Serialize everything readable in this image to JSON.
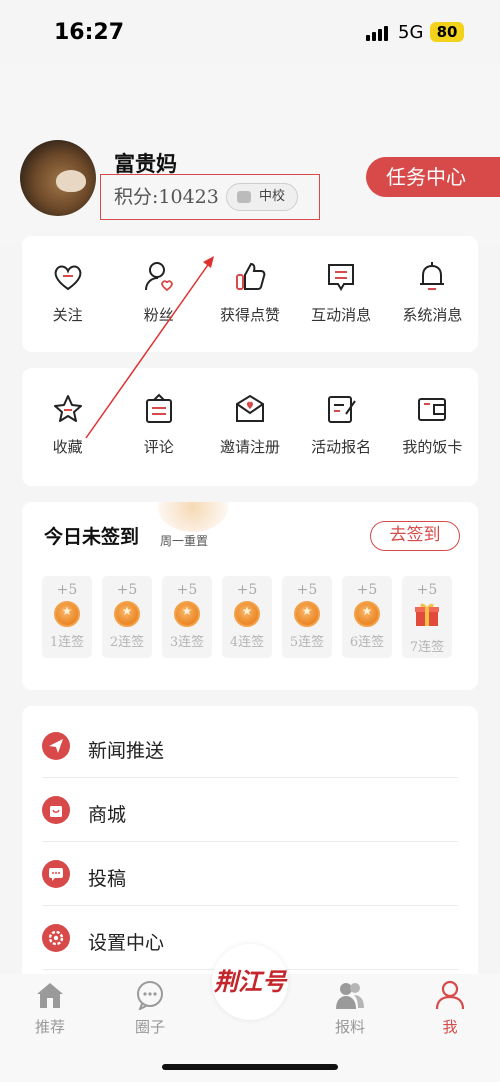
{
  "status_bar": {
    "time": "16:27",
    "network": "5G",
    "battery": "80"
  },
  "profile": {
    "username": "富贵妈",
    "points": "积分:10423",
    "level": "中校",
    "task_center": "任务中心"
  },
  "activity_row": [
    {
      "label": "关注",
      "icon": "heart-icon"
    },
    {
      "label": "粉丝",
      "icon": "fans-icon"
    },
    {
      "label": "获得点赞",
      "icon": "thumbs-up-icon"
    },
    {
      "label": "互动消息",
      "icon": "message-icon"
    },
    {
      "label": "系统消息",
      "icon": "bell-icon"
    }
  ],
  "service_row": [
    {
      "label": "收藏",
      "icon": "star-icon"
    },
    {
      "label": "评论",
      "icon": "comment-icon"
    },
    {
      "label": "邀请注册",
      "icon": "invite-icon"
    },
    {
      "label": "活动报名",
      "icon": "signup-icon"
    },
    {
      "label": "我的饭卡",
      "icon": "wallet-icon"
    }
  ],
  "signin": {
    "title": "今日未签到",
    "subtitle": "周一重置",
    "button": "去签到",
    "days": [
      {
        "plus": "+5",
        "label": "1连签"
      },
      {
        "plus": "+5",
        "label": "2连签"
      },
      {
        "plus": "+5",
        "label": "3连签"
      },
      {
        "plus": "+5",
        "label": "4连签"
      },
      {
        "plus": "+5",
        "label": "5连签"
      },
      {
        "plus": "+5",
        "label": "6连签"
      },
      {
        "plus": "+5",
        "label": "7连签"
      }
    ]
  },
  "menu": [
    {
      "label": "新闻推送",
      "icon": "paper-plane-icon"
    },
    {
      "label": "商城",
      "icon": "shop-bag-icon"
    },
    {
      "label": "投稿",
      "icon": "chat-dots-icon"
    },
    {
      "label": "设置中心",
      "icon": "gear-icon"
    }
  ],
  "tabbar": {
    "tabs": [
      {
        "label": "推荐",
        "icon": "home-icon"
      },
      {
        "label": "圈子",
        "icon": "circle-chat-icon"
      },
      {
        "label": "报料",
        "icon": "people-icon"
      },
      {
        "label": "我",
        "icon": "user-icon"
      }
    ],
    "center_logo": "荆江号",
    "active_color": "#d84a4a"
  },
  "colors": {
    "accent": "#d84a4a",
    "annotation": "#e03030"
  }
}
